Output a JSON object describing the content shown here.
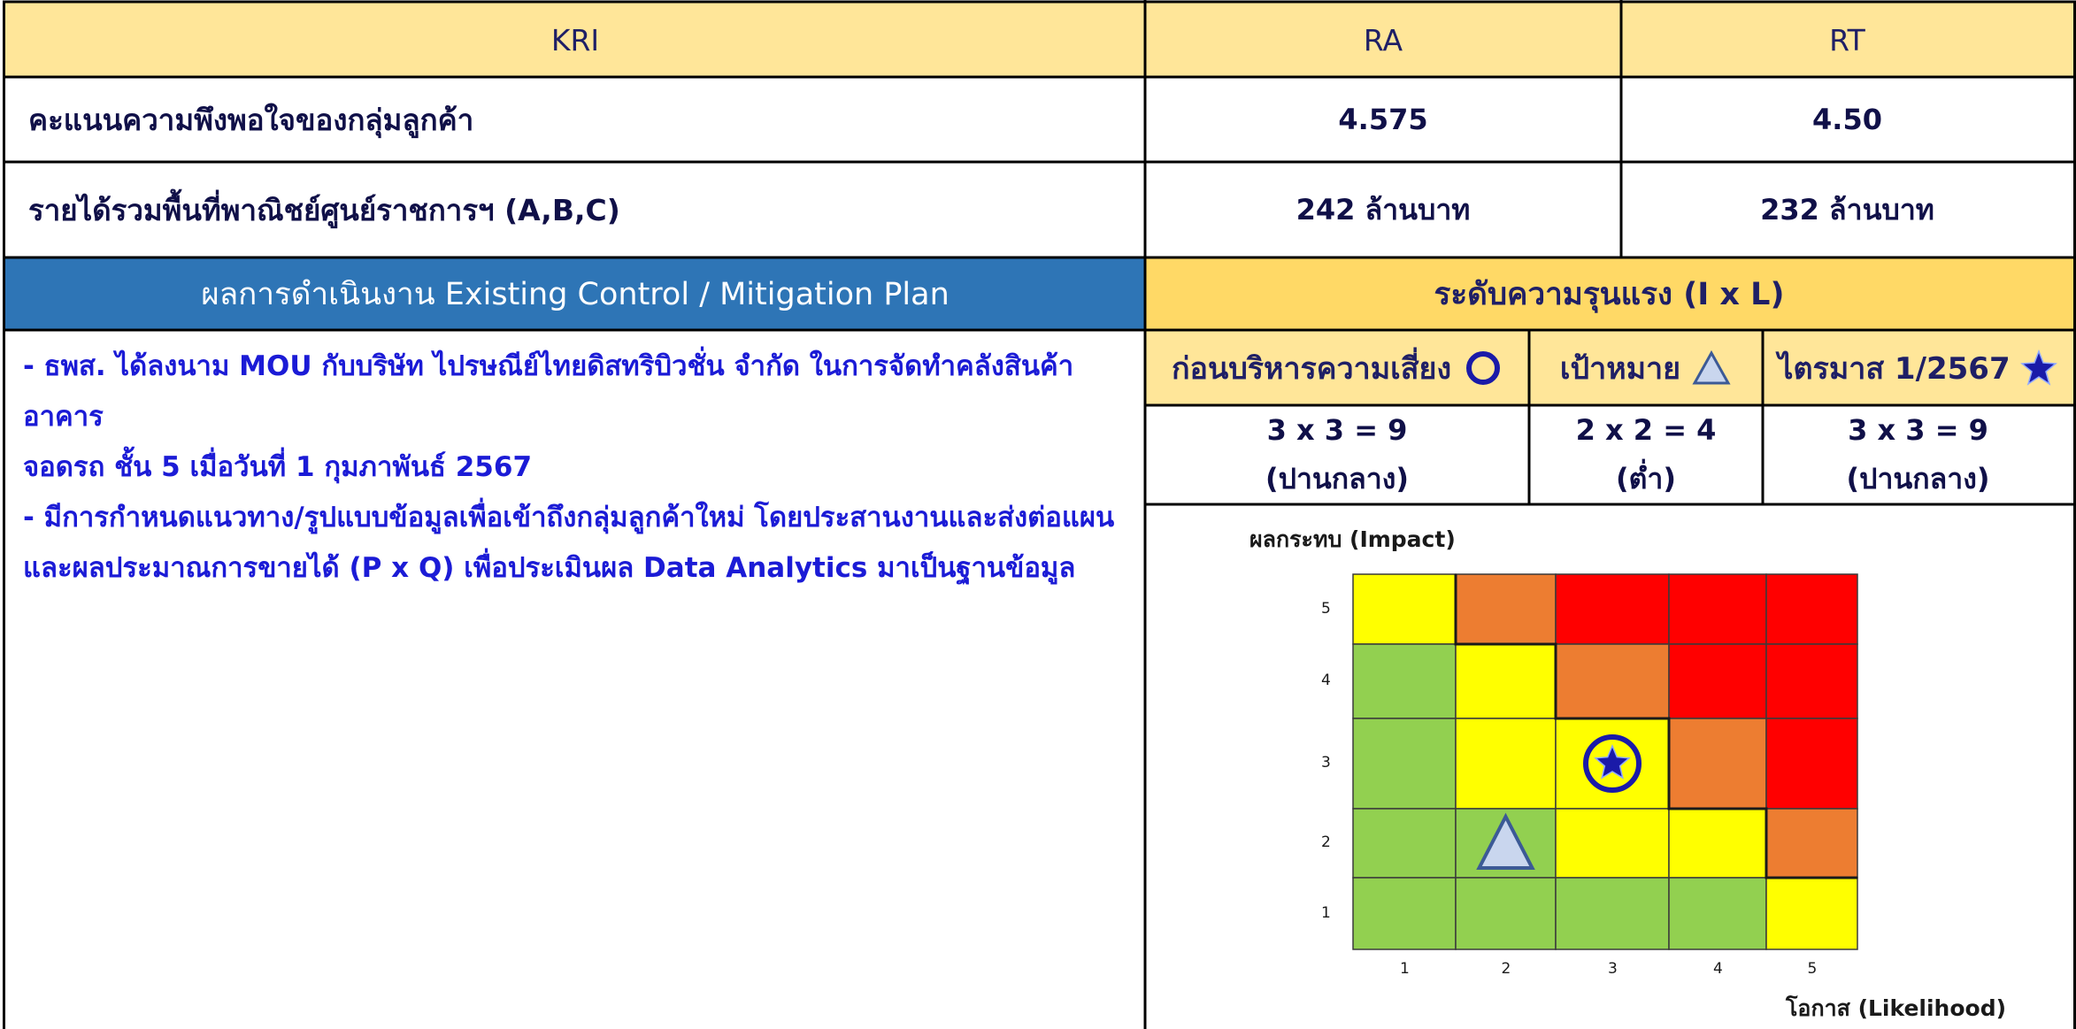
{
  "table": {
    "col_kri": "KRI",
    "col_ra": "RA",
    "col_rt": "RT",
    "rows": [
      {
        "label": "คะแนนความพึงพอใจของกลุ่มลูกค้า",
        "ra": "4.575",
        "rt": "4.50"
      },
      {
        "label": "รายได้รวมพื้นที่พาณิชย์ศูนย์ราชการฯ (A,B,C)",
        "ra": "242 ล้านบาท",
        "rt": "232 ล้านบาท"
      }
    ]
  },
  "control": {
    "header": "ผลการดำเนินงาน Existing Control / Mitigation Plan",
    "lines": [
      "- ธพส. ได้ลงนาม MOU กับบริษัท ไปรษณีย์ไทยดิสทริบิวชั่น จำกัด ในการจัดทำคลังสินค้าอาคาร",
      "จอดรถ ชั้น 5 เมื่อวันที่ 1 กุมภาพันธ์ 2567",
      "- มีการกำหนดแนวทาง/รูปแบบข้อมูลเพื่อเข้าถึงกลุ่มลูกค้าใหม่ โดยประสานงานและส่งต่อแผน",
      "และผลประมาณการขายได้ (P x Q) เพื่อประเมินผล Data Analytics มาเป็นฐานข้อมูล"
    ]
  },
  "severity": {
    "header": "ระดับความรุนแรง (I x L)",
    "columns": [
      {
        "title": "ก่อนบริหารความเสี่ยง",
        "marker": "circle-marker-icon",
        "score": "3 x 3 = 9",
        "level": "(ปานกลาง)"
      },
      {
        "title": "เป้าหมาย",
        "marker": "triangle-marker-icon",
        "score": "2 x 2 = 4",
        "level": "(ต่ำ)"
      },
      {
        "title": "ไตรมาส 1/2567",
        "marker": "star-marker-icon",
        "score": "3 x 3 = 9",
        "level": "(ปานกลาง)"
      }
    ]
  },
  "chart_data": {
    "type": "heatmap",
    "ylabel": "ผลกระทบ (Impact)",
    "xlabel": "โอกาส (Likelihood)",
    "x_ticks": [
      "1",
      "2",
      "3",
      "4",
      "5"
    ],
    "y_ticks": [
      "5",
      "4",
      "3",
      "2",
      "1"
    ],
    "cells": [
      [
        "yellow",
        "orange",
        "red",
        "red",
        "red"
      ],
      [
        "green",
        "yellow",
        "orange",
        "red",
        "red"
      ],
      [
        "green",
        "yellow",
        "yellow",
        "orange",
        "red"
      ],
      [
        "green",
        "green",
        "yellow",
        "yellow",
        "orange"
      ],
      [
        "green",
        "green",
        "green",
        "green",
        "yellow"
      ]
    ],
    "colors": {
      "green": "#92d050",
      "yellow": "#ffff00",
      "orange": "#ed7d31",
      "red": "#ff0000"
    },
    "markers": [
      {
        "name": "circle",
        "likelihood": 3,
        "impact": 3
      },
      {
        "name": "star",
        "likelihood": 3,
        "impact": 3
      },
      {
        "name": "triangle",
        "likelihood": 2,
        "impact": 2
      }
    ]
  },
  "colors": {
    "header_yellow": "#ffe699",
    "header_gold": "#ffd966",
    "header_blue": "#2e75b6",
    "text_blue": "#1b1bd6",
    "marker_navy": "#1a1aa8"
  }
}
